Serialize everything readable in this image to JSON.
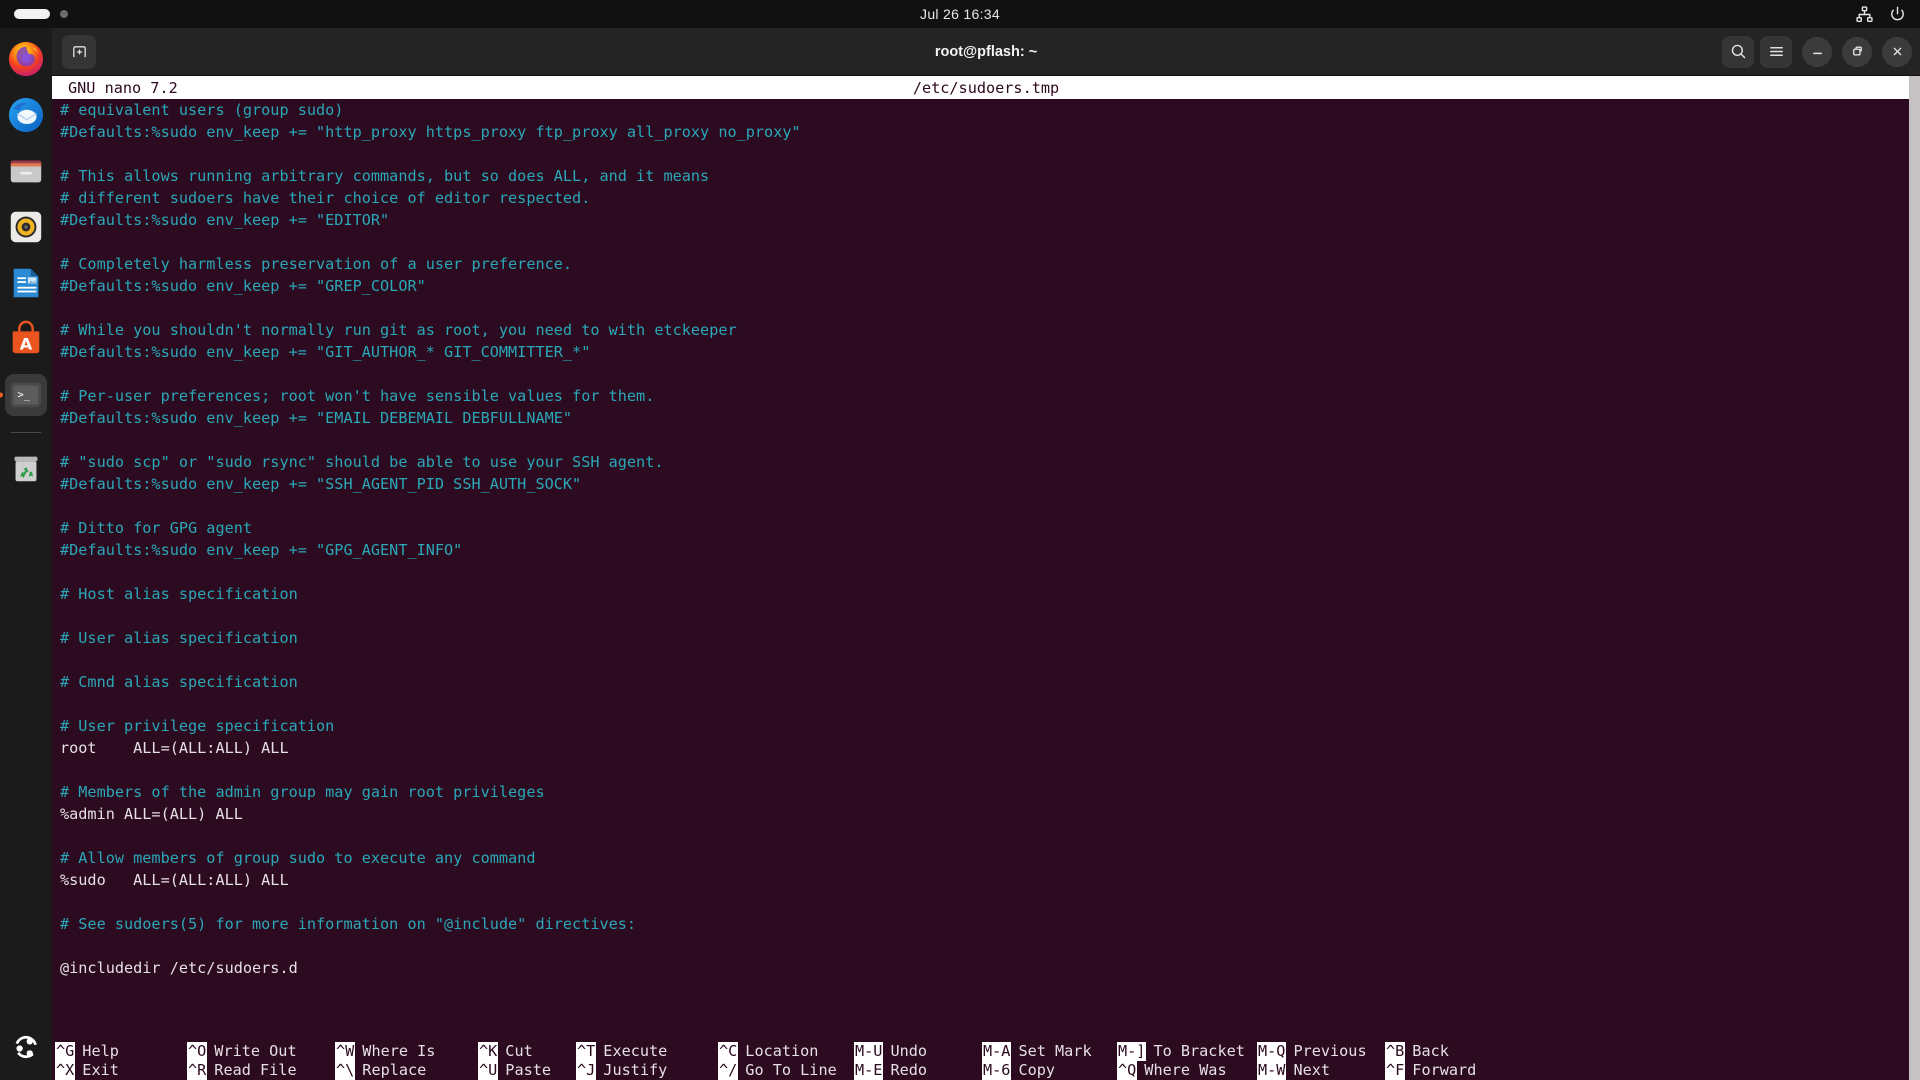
{
  "topbar": {
    "clock": "Jul 26  16:34",
    "activities_label": "Activities",
    "network_icon": "network-icon",
    "power_icon": "power-icon"
  },
  "dock": {
    "items": [
      {
        "name": "firefox",
        "label": "Firefox"
      },
      {
        "name": "thunderbird",
        "label": "Thunderbird Mail"
      },
      {
        "name": "files",
        "label": "Files"
      },
      {
        "name": "rhythmbox",
        "label": "Rhythmbox"
      },
      {
        "name": "writer",
        "label": "LibreOffice Writer"
      },
      {
        "name": "app-center",
        "label": "Ubuntu App Center"
      },
      {
        "name": "terminal",
        "label": "Terminal",
        "active": true
      },
      {
        "name": "trash",
        "label": "Trash"
      }
    ],
    "show_apps_label": "Show Applications"
  },
  "window": {
    "title": "root@pflash: ~",
    "new_tab_label": "New Tab",
    "search_label": "Search",
    "menu_label": "Main Menu",
    "minimize_label": "Minimize",
    "maximize_label": "Restore",
    "close_label": "Close"
  },
  "nano": {
    "version": "GNU nano 7.2",
    "filename": "/etc/sudoers.tmp",
    "lines": [
      {
        "text": "# equivalent users (group sudo)",
        "style": "cmt"
      },
      {
        "text": "#Defaults:%sudo env_keep += \"http_proxy https_proxy ftp_proxy all_proxy no_proxy\"",
        "style": "cmt"
      },
      {
        "text": "",
        "style": "cmt"
      },
      {
        "text": "# This allows running arbitrary commands, but so does ALL, and it means",
        "style": "cmt"
      },
      {
        "text": "# different sudoers have their choice of editor respected.",
        "style": "cmt"
      },
      {
        "text": "#Defaults:%sudo env_keep += \"EDITOR\"",
        "style": "cmt"
      },
      {
        "text": "",
        "style": "cmt"
      },
      {
        "text": "# Completely harmless preservation of a user preference.",
        "style": "cmt"
      },
      {
        "text": "#Defaults:%sudo env_keep += \"GREP_COLOR\"",
        "style": "cmt"
      },
      {
        "text": "",
        "style": "cmt"
      },
      {
        "text": "# While you shouldn't normally run git as root, you need to with etckeeper",
        "style": "cmt"
      },
      {
        "text": "#Defaults:%sudo env_keep += \"GIT_AUTHOR_* GIT_COMMITTER_*\"",
        "style": "cmt"
      },
      {
        "text": "",
        "style": "cmt"
      },
      {
        "text": "# Per-user preferences; root won't have sensible values for them.",
        "style": "cmt"
      },
      {
        "text": "#Defaults:%sudo env_keep += \"EMAIL DEBEMAIL DEBFULLNAME\"",
        "style": "cmt"
      },
      {
        "text": "",
        "style": "cmt"
      },
      {
        "text": "# \"sudo scp\" or \"sudo rsync\" should be able to use your SSH agent.",
        "style": "cmt"
      },
      {
        "text": "#Defaults:%sudo env_keep += \"SSH_AGENT_PID SSH_AUTH_SOCK\"",
        "style": "cmt"
      },
      {
        "text": "",
        "style": "cmt"
      },
      {
        "text": "# Ditto for GPG agent",
        "style": "cmt"
      },
      {
        "text": "#Defaults:%sudo env_keep += \"GPG_AGENT_INFO\"",
        "style": "cmt"
      },
      {
        "text": "",
        "style": "cmt"
      },
      {
        "text": "# Host alias specification",
        "style": "cmt"
      },
      {
        "text": "",
        "style": "cmt"
      },
      {
        "text": "# User alias specification",
        "style": "cmt"
      },
      {
        "text": "",
        "style": "cmt"
      },
      {
        "text": "# Cmnd alias specification",
        "style": "cmt"
      },
      {
        "text": "",
        "style": "cmt"
      },
      {
        "text": "# User privilege specification",
        "style": "cmt"
      },
      {
        "text": "root    ALL=(ALL:ALL) ALL",
        "style": "txt"
      },
      {
        "text": "",
        "style": "cmt"
      },
      {
        "text": "# Members of the admin group may gain root privileges",
        "style": "cmt"
      },
      {
        "text": "%admin ALL=(ALL) ALL",
        "style": "txt"
      },
      {
        "text": "",
        "style": "cmt"
      },
      {
        "text": "# Allow members of group sudo to execute any command",
        "style": "cmt"
      },
      {
        "text": "%sudo   ALL=(ALL:ALL) ALL",
        "style": "txt"
      },
      {
        "text": "",
        "style": "cmt"
      },
      {
        "text": "# See sudoers(5) for more information on \"@include\" directives:",
        "style": "cmt"
      },
      {
        "text": "",
        "style": "cmt"
      },
      {
        "text": "@includedir /etc/sudoers.d",
        "style": "txt"
      }
    ],
    "shortcuts": [
      [
        {
          "key": "^G",
          "label": "Help"
        },
        {
          "key": "^X",
          "label": "Exit"
        }
      ],
      [
        {
          "key": "^O",
          "label": "Write Out"
        },
        {
          "key": "^R",
          "label": "Read File"
        }
      ],
      [
        {
          "key": "^W",
          "label": "Where Is"
        },
        {
          "key": "^\\",
          "label": "Replace"
        }
      ],
      [
        {
          "key": "^K",
          "label": "Cut"
        },
        {
          "key": "^U",
          "label": "Paste"
        }
      ],
      [
        {
          "key": "^T",
          "label": "Execute"
        },
        {
          "key": "^J",
          "label": "Justify"
        }
      ],
      [
        {
          "key": "^C",
          "label": "Location"
        },
        {
          "key": "^/",
          "label": "Go To Line"
        }
      ],
      [
        {
          "key": "M-U",
          "label": "Undo"
        },
        {
          "key": "M-E",
          "label": "Redo"
        }
      ],
      [
        {
          "key": "M-A",
          "label": "Set Mark"
        },
        {
          "key": "M-6",
          "label": "Copy"
        }
      ],
      [
        {
          "key": "M-]",
          "label": "To Bracket"
        },
        {
          "key": "^Q",
          "label": "Where Was"
        }
      ],
      [
        {
          "key": "M-Q",
          "label": "Previous"
        },
        {
          "key": "M-W",
          "label": "Next"
        }
      ],
      [
        {
          "key": "^B",
          "label": "Back"
        },
        {
          "key": "^F",
          "label": "Forward"
        }
      ]
    ]
  },
  "colors": {
    "terminal_bg": "#2c0a1f",
    "comment": "#2aa8b8",
    "text": "#e6e0e4",
    "titlebar": "#242424",
    "topbar": "#111111",
    "dock": "#1b1b1b",
    "accent": "#e8601c"
  }
}
